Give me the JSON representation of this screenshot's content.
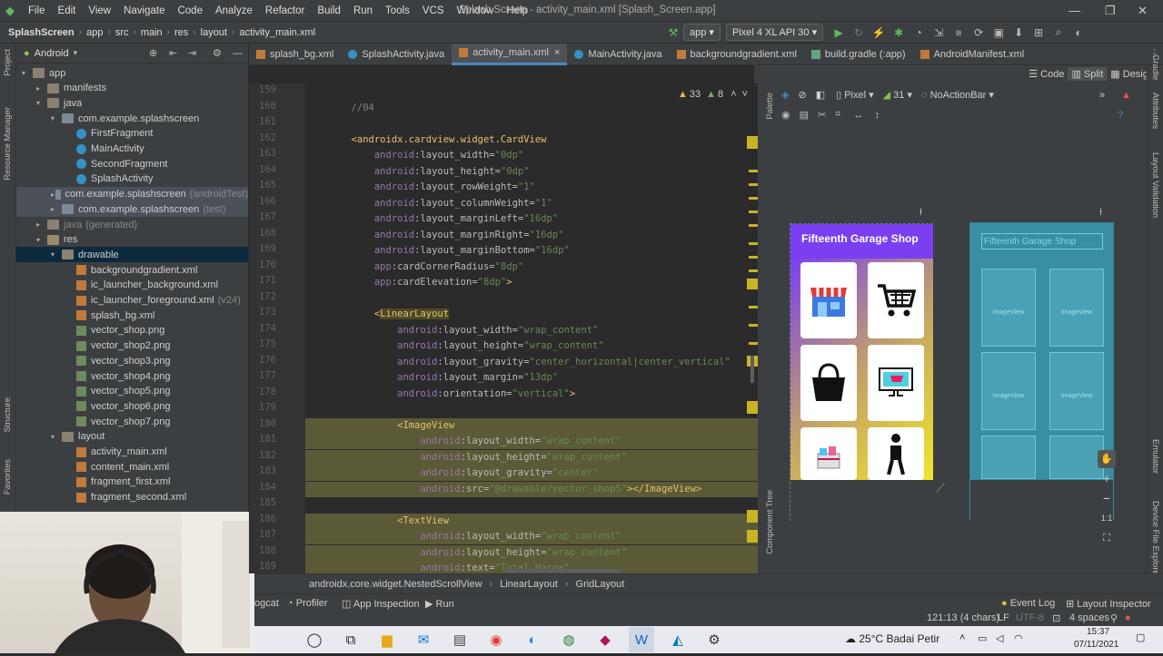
{
  "menu": [
    "File",
    "Edit",
    "View",
    "Navigate",
    "Code",
    "Analyze",
    "Refactor",
    "Build",
    "Run",
    "Tools",
    "VCS",
    "Window",
    "Help"
  ],
  "window_title": "Splash Screen - activity_main.xml [Splash_Screen.app]",
  "breadcrumb": [
    "SplashScreen",
    "app",
    "src",
    "main",
    "res",
    "layout",
    "activity_main.xml"
  ],
  "run_config": "app",
  "device": "Pixel 4 XL API 30",
  "project": {
    "view": "Android",
    "items": [
      {
        "t": "app",
        "d": 0,
        "k": "folder",
        "open": true
      },
      {
        "t": "manifests",
        "d": 1,
        "k": "folder"
      },
      {
        "t": "java",
        "d": 1,
        "k": "folder",
        "open": true
      },
      {
        "t": "com.example.splashscreen",
        "d": 2,
        "k": "pkg",
        "open": true
      },
      {
        "t": "FirstFragment",
        "d": 3,
        "k": "cls"
      },
      {
        "t": "MainActivity",
        "d": 3,
        "k": "cls"
      },
      {
        "t": "SecondFragment",
        "d": 3,
        "k": "cls"
      },
      {
        "t": "SplashActivity",
        "d": 3,
        "k": "cls"
      },
      {
        "t": "com.example.splashscreen",
        "s": "(androidTest)",
        "d": 2,
        "k": "pkg",
        "hl": true
      },
      {
        "t": "com.example.splashscreen",
        "s": "(test)",
        "d": 2,
        "k": "pkg",
        "hl": true
      },
      {
        "t": "java",
        "s": "(generated)",
        "d": 1,
        "k": "folder",
        "dim": true
      },
      {
        "t": "res",
        "d": 1,
        "k": "res",
        "open": true
      },
      {
        "t": "drawable",
        "d": 2,
        "k": "folder",
        "open": true,
        "sel": true
      },
      {
        "t": "backgroundgradient.xml",
        "d": 3,
        "k": "xml"
      },
      {
        "t": "ic_launcher_background.xml",
        "d": 3,
        "k": "xml"
      },
      {
        "t": "ic_launcher_foreground.xml",
        "s": "(v24)",
        "d": 3,
        "k": "xml"
      },
      {
        "t": "splash_bg.xml",
        "d": 3,
        "k": "xml"
      },
      {
        "t": "vector_shop.png",
        "d": 3,
        "k": "png"
      },
      {
        "t": "vector_shop2.png",
        "d": 3,
        "k": "png"
      },
      {
        "t": "vector_shop3.png",
        "d": 3,
        "k": "png"
      },
      {
        "t": "vector_shop4.png",
        "d": 3,
        "k": "png"
      },
      {
        "t": "vector_shop5.png",
        "d": 3,
        "k": "png"
      },
      {
        "t": "vector_shop6.png",
        "d": 3,
        "k": "png"
      },
      {
        "t": "vector_shop7.png",
        "d": 3,
        "k": "png"
      },
      {
        "t": "layout",
        "d": 2,
        "k": "folder",
        "open": true
      },
      {
        "t": "activity_main.xml",
        "d": 3,
        "k": "xml"
      },
      {
        "t": "content_main.xml",
        "d": 3,
        "k": "xml"
      },
      {
        "t": "fragment_first.xml",
        "d": 3,
        "k": "xml"
      },
      {
        "t": "fragment_second.xml",
        "d": 3,
        "k": "xml"
      }
    ]
  },
  "tabs": [
    {
      "label": "splash_bg.xml",
      "k": "xml"
    },
    {
      "label": "SplashActivity.java",
      "k": "cls"
    },
    {
      "label": "activity_main.xml",
      "k": "xml",
      "active": true
    },
    {
      "label": "MainActivity.java",
      "k": "cls"
    },
    {
      "label": "backgroundgradient.xml",
      "k": "xml"
    },
    {
      "label": "build.gradle (:app)",
      "k": "gradle"
    },
    {
      "label": "AndroidManifest.xml",
      "k": "xml"
    }
  ],
  "view_modes": [
    "Code",
    "Split",
    "Design"
  ],
  "editor_badge": {
    "warnings": "33",
    "weak": "8"
  },
  "code": [
    {
      "n": "159",
      "p": [
        [
          "cmt",
          ""
        ]
      ]
    },
    {
      "n": "160",
      "p": [
        [
          "cmt",
          "        //04"
        ]
      ]
    },
    {
      "n": "161",
      "p": [
        [
          "att",
          ""
        ]
      ]
    },
    {
      "n": "162",
      "p": [
        [
          "tag",
          "        <androidx.cardview.widget.CardView"
        ]
      ]
    },
    {
      "n": "163",
      "p": [
        [
          "att",
          "            "
        ],
        [
          "ans",
          "android"
        ],
        [
          "att",
          ":layout_width="
        ],
        [
          "val",
          "\"0dp\""
        ]
      ]
    },
    {
      "n": "164",
      "p": [
        [
          "att",
          "            "
        ],
        [
          "ans",
          "android"
        ],
        [
          "att",
          ":layout_height="
        ],
        [
          "val",
          "\"0dp\""
        ]
      ]
    },
    {
      "n": "165",
      "p": [
        [
          "att",
          "            "
        ],
        [
          "ans",
          "android"
        ],
        [
          "att",
          ":layout_rowWeight="
        ],
        [
          "val",
          "\"1\""
        ]
      ]
    },
    {
      "n": "166",
      "p": [
        [
          "att",
          "            "
        ],
        [
          "ans",
          "android"
        ],
        [
          "att",
          ":layout_columnWeight="
        ],
        [
          "val",
          "\"1\""
        ]
      ]
    },
    {
      "n": "167",
      "p": [
        [
          "att",
          "            "
        ],
        [
          "ans",
          "android"
        ],
        [
          "att",
          ":layout_marginLeft="
        ],
        [
          "val",
          "\"16dp\""
        ]
      ]
    },
    {
      "n": "168",
      "p": [
        [
          "att",
          "            "
        ],
        [
          "ans",
          "android"
        ],
        [
          "att",
          ":layout_marginRight="
        ],
        [
          "val",
          "\"16dp\""
        ]
      ]
    },
    {
      "n": "169",
      "p": [
        [
          "att",
          "            "
        ],
        [
          "ans",
          "android"
        ],
        [
          "att",
          ":layout_marginBottom="
        ],
        [
          "val",
          "\"16dp\""
        ]
      ]
    },
    {
      "n": "170",
      "p": [
        [
          "att",
          "            "
        ],
        [
          "ans",
          "app"
        ],
        [
          "att",
          ":cardCornerRadius="
        ],
        [
          "val",
          "\"8dp\""
        ]
      ]
    },
    {
      "n": "171",
      "p": [
        [
          "att",
          "            "
        ],
        [
          "ans",
          "app"
        ],
        [
          "att",
          ":cardElevation="
        ],
        [
          "val",
          "\"8dp\""
        ],
        [
          "tag",
          ">"
        ]
      ]
    },
    {
      "n": "172",
      "p": [
        [
          "att",
          ""
        ]
      ]
    },
    {
      "n": "173",
      "p": [
        [
          "tag",
          "            <"
        ],
        [
          "selt",
          "LinearLayout"
        ]
      ]
    },
    {
      "n": "174",
      "p": [
        [
          "att",
          "                "
        ],
        [
          "ans",
          "android"
        ],
        [
          "att",
          ":layout_width="
        ],
        [
          "val",
          "\"wrap_content\""
        ]
      ]
    },
    {
      "n": "175",
      "p": [
        [
          "att",
          "                "
        ],
        [
          "ans",
          "android"
        ],
        [
          "att",
          ":layout_height="
        ],
        [
          "val",
          "\"wrap_content\""
        ]
      ]
    },
    {
      "n": "176",
      "p": [
        [
          "att",
          "                "
        ],
        [
          "ans",
          "android"
        ],
        [
          "att",
          ":layout_gravity="
        ],
        [
          "val",
          "\"center_horizontal|center_vertical\""
        ]
      ]
    },
    {
      "n": "177",
      "p": [
        [
          "att",
          "                "
        ],
        [
          "ans",
          "android"
        ],
        [
          "att",
          ":layout_margin="
        ],
        [
          "val",
          "\"13dp\""
        ]
      ]
    },
    {
      "n": "178",
      "p": [
        [
          "att",
          "                "
        ],
        [
          "ans",
          "android"
        ],
        [
          "att",
          ":orientation="
        ],
        [
          "val",
          "\"vertical\""
        ],
        [
          "tag",
          ">"
        ]
      ]
    },
    {
      "n": "179",
      "p": [
        [
          "att",
          ""
        ]
      ]
    },
    {
      "n": "180",
      "sel": true,
      "p": [
        [
          "att",
          "                "
        ],
        [
          "tag",
          "<ImageView"
        ]
      ]
    },
    {
      "n": "181",
      "sel": true,
      "p": [
        [
          "att",
          "                    "
        ],
        [
          "ans",
          "android"
        ],
        [
          "att",
          ":layout_width="
        ],
        [
          "val",
          "\"wrap_content\""
        ]
      ]
    },
    {
      "n": "182",
      "sel": true,
      "p": [
        [
          "att",
          "                    "
        ],
        [
          "ans",
          "android"
        ],
        [
          "att",
          ":layout_height="
        ],
        [
          "val",
          "\"wrap_content\""
        ]
      ]
    },
    {
      "n": "183",
      "sel": true,
      "p": [
        [
          "att",
          "                    "
        ],
        [
          "ans",
          "android"
        ],
        [
          "att",
          ":layout_gravity="
        ],
        [
          "val",
          "\"center\""
        ]
      ]
    },
    {
      "n": "184",
      "sel": true,
      "p": [
        [
          "att",
          "                    "
        ],
        [
          "ans",
          "android"
        ],
        [
          "att",
          ":src="
        ],
        [
          "val",
          "\"@drawable/vector_shop5\""
        ],
        [
          "tag",
          "></ImageView>"
        ]
      ]
    },
    {
      "n": "185",
      "p": [
        [
          "att",
          ""
        ]
      ]
    },
    {
      "n": "186",
      "sel": true,
      "p": [
        [
          "att",
          "                "
        ],
        [
          "tag",
          "<TextView"
        ]
      ]
    },
    {
      "n": "187",
      "sel": true,
      "p": [
        [
          "att",
          "                    "
        ],
        [
          "ans",
          "android"
        ],
        [
          "att",
          ":layout_width="
        ],
        [
          "val",
          "\"wrap_content\""
        ]
      ]
    },
    {
      "n": "188",
      "sel": true,
      "p": [
        [
          "att",
          "                    "
        ],
        [
          "ans",
          "android"
        ],
        [
          "att",
          ":layout_height="
        ],
        [
          "val",
          "\"wrap_content\""
        ]
      ]
    },
    {
      "n": "189",
      "sel": true,
      "p": [
        [
          "att",
          "                    "
        ],
        [
          "ans",
          "android"
        ],
        [
          "att",
          ":text="
        ],
        [
          "val",
          "\"Total Harga\""
        ]
      ]
    }
  ],
  "design_toolbar": {
    "device": "Pixel",
    "api": "31",
    "theme": "NoActionBar"
  },
  "preview": {
    "title": "Fifteenth Garage Shop",
    "blueprint_title": "Fifteenth Garage Shop",
    "image_label": "ImageView",
    "cards": [
      "store-icon",
      "cart-icon",
      "bag-icon",
      "monitor-icon",
      "gift-icon",
      "walker-icon"
    ]
  },
  "side_labels": {
    "left": [
      "Project",
      "Resource Manager",
      "Structure",
      "Favorites"
    ],
    "right": [
      "Gradle",
      "Attributes",
      "Layout Validation",
      "Emulator",
      "Device File Explorer"
    ],
    "palette": "Palette",
    "component_tree": "Component Tree"
  },
  "editor_breadcrumb": [
    "androidx.core.widget.NestedScrollView",
    "LinearLayout",
    "GridLayout"
  ],
  "bottom_tools": [
    "ogcat",
    "Profiler",
    "App Inspection",
    "Run",
    "Event Log",
    "Layout Inspector"
  ],
  "status": {
    "pos": "121:13 (4 chars)",
    "lf": "LF",
    "enc": "UTF-8",
    "indent": "4 spaces"
  },
  "taskbar": {
    "weather": "25°C Badai Petir",
    "time": "15:37",
    "date": "07/11/2021"
  }
}
